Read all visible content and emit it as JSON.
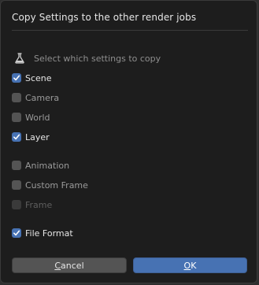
{
  "dialog": {
    "title": "Copy Settings to the other render jobs",
    "subtitle": "Select which settings to copy",
    "subtitle_icon": "flask-icon"
  },
  "options": [
    {
      "label": "Scene",
      "checked": true,
      "enabled": true
    },
    {
      "label": "Camera",
      "checked": false,
      "enabled": true
    },
    {
      "label": "World",
      "checked": false,
      "enabled": true
    },
    {
      "label": "Layer",
      "checked": true,
      "enabled": true
    },
    {
      "label": "Animation",
      "checked": false,
      "enabled": true
    },
    {
      "label": "Custom Frame",
      "checked": false,
      "enabled": true
    },
    {
      "label": "Frame",
      "checked": false,
      "enabled": false
    },
    {
      "label": "File Format",
      "checked": true,
      "enabled": true
    }
  ],
  "buttons": {
    "cancel_first": "C",
    "cancel_rest": "ancel",
    "ok_first": "O",
    "ok_rest": "K"
  },
  "colors": {
    "accent": "#4772b3",
    "background": "#1d1d1d",
    "text": "#e6e6e6"
  }
}
